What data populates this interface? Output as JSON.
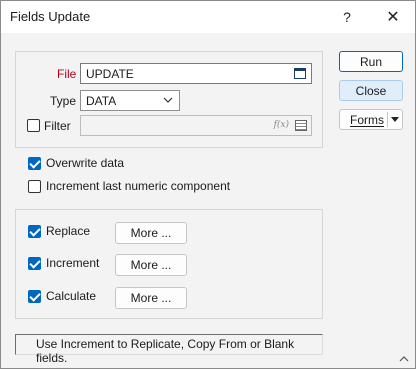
{
  "window": {
    "title": "Fields Update",
    "help_glyph": "?",
    "close_glyph": "✕"
  },
  "file_group": {
    "file_label": "File",
    "file_value": "UPDATE",
    "type_label": "Type",
    "type_value": "DATA",
    "filter_label": "Filter",
    "filter_checked": false,
    "fx_glyph": "f(x)"
  },
  "options": {
    "overwrite_label": "Overwrite data",
    "overwrite_checked": true,
    "increment_last_label": "Increment last numeric component",
    "increment_last_checked": false
  },
  "actions": {
    "replace_label": "Replace",
    "replace_checked": true,
    "increment_label": "Increment",
    "increment_checked": true,
    "calculate_label": "Calculate",
    "calculate_checked": true,
    "more_label": "More ..."
  },
  "buttons": {
    "run": "Run",
    "close": "Close",
    "forms": "Forms"
  },
  "status": {
    "text": "Use Increment to Replicate, Copy From or Blank fields."
  },
  "colors": {
    "accent": "#0067c0",
    "required": "#b3001b"
  }
}
